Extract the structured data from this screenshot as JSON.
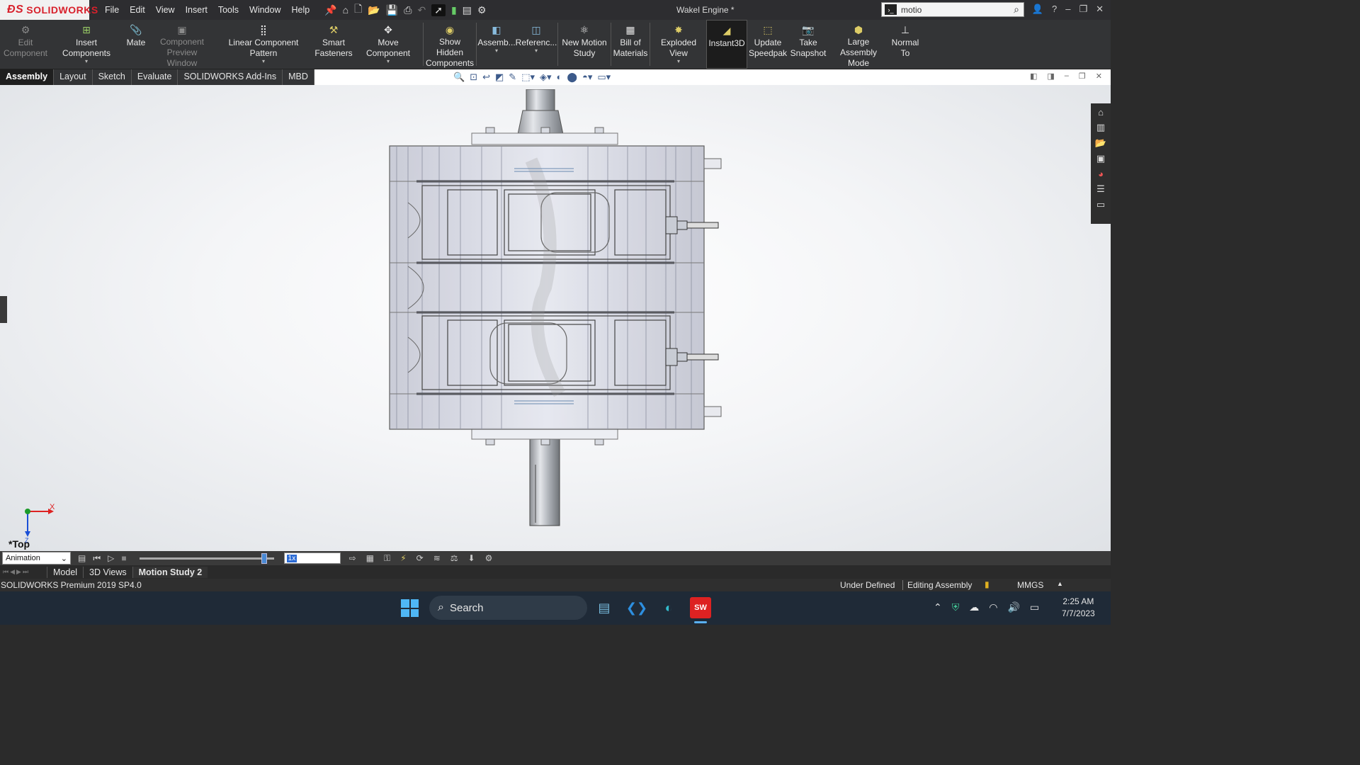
{
  "app": {
    "logo_text": "SOLIDWORKS",
    "document_title": "Wakel Engine *"
  },
  "menu": [
    "File",
    "Edit",
    "View",
    "Insert",
    "Tools",
    "Window",
    "Help"
  ],
  "search": {
    "value": "motio"
  },
  "command_manager": {
    "buttons": [
      {
        "label": "Edit Component",
        "enabled": false
      },
      {
        "label": "Insert Components",
        "enabled": true
      },
      {
        "label": "Mate",
        "enabled": true
      },
      {
        "label": "Component Preview Window",
        "enabled": false
      },
      {
        "label": "Linear Component Pattern",
        "enabled": true
      },
      {
        "label": "Smart Fasteners",
        "enabled": true
      },
      {
        "label": "Move Component",
        "enabled": true
      },
      {
        "label": "Show Hidden Components",
        "enabled": true
      },
      {
        "label": "Assemb...",
        "enabled": true
      },
      {
        "label": "Referenc...",
        "enabled": true
      },
      {
        "label": "New Motion Study",
        "enabled": true
      },
      {
        "label": "Bill of Materials",
        "enabled": true
      },
      {
        "label": "Exploded View",
        "enabled": true
      },
      {
        "label": "Instant3D",
        "enabled": true,
        "active": true
      },
      {
        "label": "Update Speedpak",
        "enabled": true
      },
      {
        "label": "Take Snapshot",
        "enabled": true
      },
      {
        "label": "Large Assembly Mode",
        "enabled": true
      },
      {
        "label": "Normal To",
        "enabled": true
      }
    ]
  },
  "cm_tabs": [
    "Assembly",
    "Layout",
    "Sketch",
    "Evaluate",
    "SOLIDWORKS Add-Ins",
    "MBD"
  ],
  "active_cm_tab": "Assembly",
  "viewport": {
    "view_orientation": "*Top",
    "triad": {
      "x_label": "X",
      "z_label": "Z"
    }
  },
  "motion_manager": {
    "study_type": "Animation",
    "speed": "1x",
    "timeline_position": 0.93
  },
  "bottom_tabs": [
    "Model",
    "3D Views",
    "Motion Study 2"
  ],
  "active_bottom_tab": "Motion Study 2",
  "status": {
    "product": "SOLIDWORKS Premium 2019 SP4.0",
    "state": "Under Defined",
    "mode": "Editing Assembly",
    "units": "MMGS"
  },
  "taskbar": {
    "search_label": "Search",
    "time": "2:25 AM",
    "date": "7/7/2023"
  },
  "colors": {
    "brand_red": "#d8212c",
    "chrome_dark": "#333436",
    "accent_blue": "#4a8ad4"
  }
}
